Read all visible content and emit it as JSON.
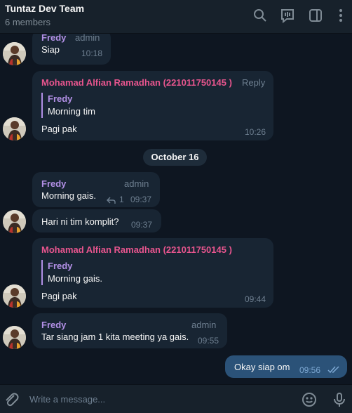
{
  "header": {
    "title": "Tuntaz Dev Team",
    "subtitle": "6 members",
    "icons": [
      "search-icon",
      "video-chat-icon",
      "sidebar-toggle-icon",
      "more-icon"
    ]
  },
  "messages": [
    {
      "sender": "Fredy",
      "tag": "admin",
      "text": "Siap",
      "time": "10:18"
    },
    {
      "sender": "Mohamad Alfian Ramadhan (221011750145 )",
      "tag": "Reply",
      "quote_name": "Fredy",
      "quote_text": "Morning tim",
      "text": "Pagi pak",
      "time": "10:26"
    },
    {
      "sender": "Fredy",
      "tag": "admin",
      "text": "Morning gais.",
      "replies": "1",
      "time": "09:37"
    },
    {
      "text": "Hari ni tim komplit?",
      "time": "09:37"
    },
    {
      "sender": "Mohamad Alfian Ramadhan (221011750145 )",
      "quote_name": "Fredy",
      "quote_text": "Morning gais.",
      "text": "Pagi pak",
      "time": "09:44"
    },
    {
      "sender": "Fredy",
      "tag": "admin",
      "text": "Tar siang jam 1 kita meeting ya gais.",
      "time": "09:55"
    },
    {
      "text": "Okay siap om",
      "time": "09:56",
      "status": "read"
    }
  ],
  "date_separator": "October 16",
  "composer": {
    "placeholder": "Write a message...",
    "icons": [
      "attach-icon",
      "emoji-icon",
      "microphone-icon"
    ]
  },
  "colors": {
    "background": "#0e1621",
    "header": "#17212b",
    "incoming_bubble": "#182533",
    "outgoing_bubble": "#2b5278",
    "accent_purple": "#b290e6",
    "accent_pink": "#e8558e"
  }
}
